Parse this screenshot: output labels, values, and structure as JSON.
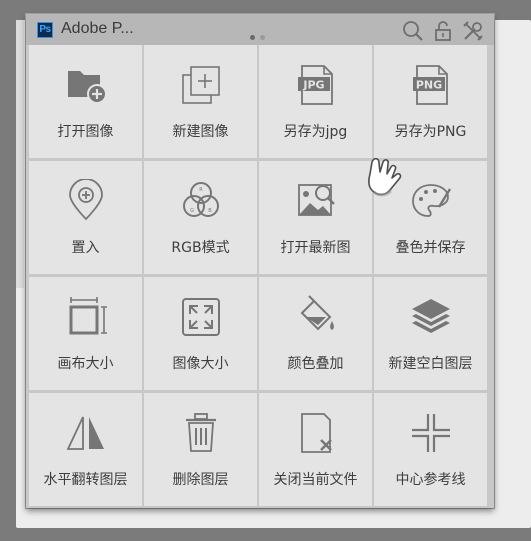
{
  "window": {
    "app_badge": "Ps",
    "title": "Adobe P...",
    "page_indicator": {
      "pages": 2,
      "current": 1
    }
  },
  "toolbar": {
    "icons": [
      "search-icon",
      "lock-icon",
      "tools-icon"
    ]
  },
  "tiles": [
    {
      "label": "打开图像",
      "icon": "open-folder-icon"
    },
    {
      "label": "新建图像",
      "icon": "new-image-icon"
    },
    {
      "label": "另存为jpg",
      "icon": "jpg-file-icon",
      "badge": "JPG"
    },
    {
      "label": "另存为PNG",
      "icon": "png-file-icon",
      "badge": "PNG"
    },
    {
      "label": "置入",
      "icon": "place-pin-icon"
    },
    {
      "label": "RGB模式",
      "icon": "rgb-circles-icon",
      "channels": [
        "R",
        "G",
        "B"
      ]
    },
    {
      "label": "打开最新图",
      "icon": "open-recent-image-icon"
    },
    {
      "label": "叠色并保存",
      "icon": "palette-icon"
    },
    {
      "label": "画布大小",
      "icon": "canvas-size-icon"
    },
    {
      "label": "图像大小",
      "icon": "image-size-icon"
    },
    {
      "label": "颜色叠加",
      "icon": "color-fill-icon"
    },
    {
      "label": "新建空白图层",
      "icon": "layers-icon"
    },
    {
      "label": "水平翻转图层",
      "icon": "flip-horizontal-icon"
    },
    {
      "label": "删除图层",
      "icon": "trash-icon"
    },
    {
      "label": "关闭当前文件",
      "icon": "close-file-icon"
    },
    {
      "label": "中心参考线",
      "icon": "center-guides-icon"
    }
  ],
  "colors": {
    "tile_bg": "#e4e4e4",
    "icon": "#767676",
    "label": "#3e3e3e",
    "panel_border": "#c8c8c8"
  }
}
